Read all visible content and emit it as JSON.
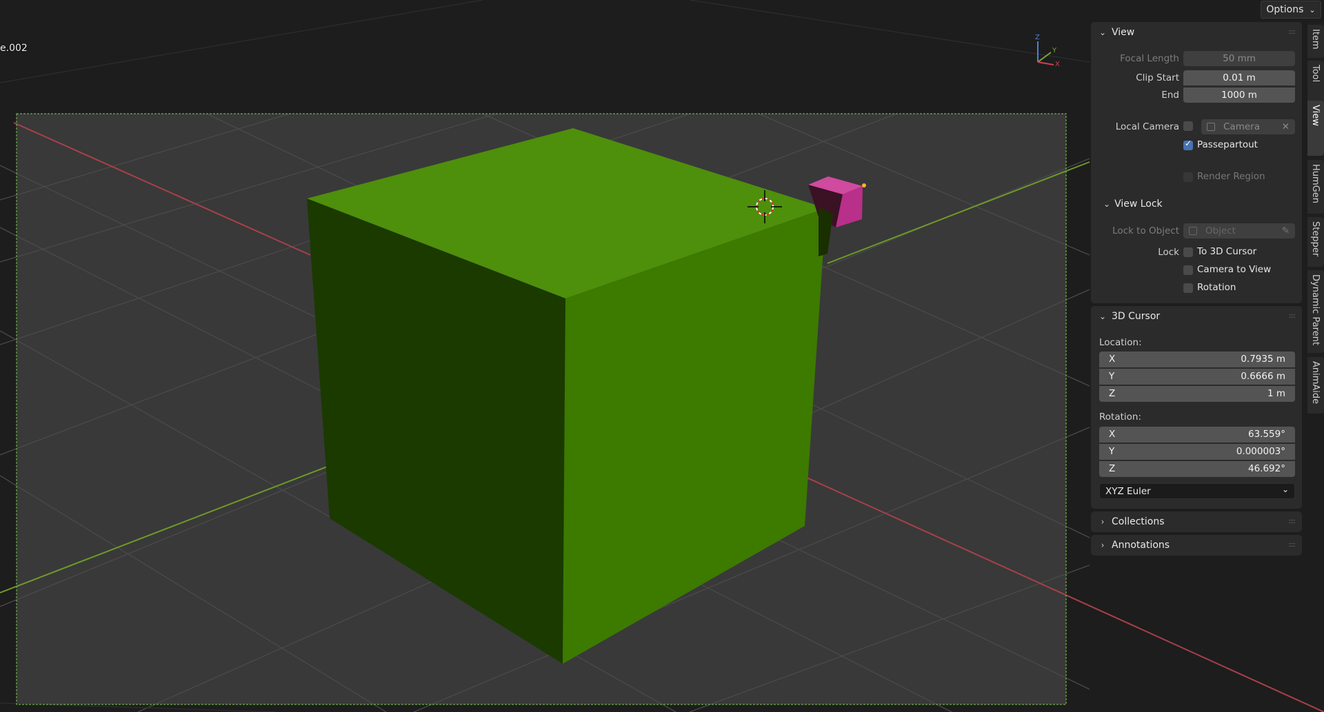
{
  "overlay": {
    "line1": "",
    "line2": "e.002"
  },
  "header": {
    "options_label": "Options"
  },
  "gizmo": {
    "z": "Z",
    "y": "Y",
    "x": "X"
  },
  "sidebar": {
    "view_panel": {
      "title": "View",
      "focal_length_label": "Focal Length",
      "focal_length_value": "50 mm",
      "clip_start_label": "Clip Start",
      "clip_start_value": "0.01 m",
      "clip_end_label": "End",
      "clip_end_value": "1000 m",
      "local_camera_label": "Local Camera",
      "local_camera_value": "Camera",
      "passepartout_label": "Passepartout",
      "passepartout_checked": true,
      "render_region_label": "Render Region",
      "view_lock": {
        "title": "View Lock",
        "lock_to_object_label": "Lock to Object",
        "lock_to_object_placeholder": "Object",
        "lock_label": "Lock",
        "to_3d_cursor_label": "To 3D Cursor",
        "camera_to_view_label": "Camera to View",
        "rotation_label": "Rotation"
      }
    },
    "cursor_panel": {
      "title": "3D Cursor",
      "location_label": "Location:",
      "location": [
        {
          "axis": "X",
          "value": "0.7935 m"
        },
        {
          "axis": "Y",
          "value": "0.6666 m"
        },
        {
          "axis": "Z",
          "value": "1 m"
        }
      ],
      "rotation_label": "Rotation:",
      "rotation": [
        {
          "axis": "X",
          "value": "63.559°"
        },
        {
          "axis": "Y",
          "value": "0.000003°"
        },
        {
          "axis": "Z",
          "value": "46.692°"
        }
      ],
      "rotation_mode": "XYZ Euler"
    },
    "collections_panel": {
      "title": "Collections"
    },
    "annotations_panel": {
      "title": "Annotations"
    }
  },
  "tabs": [
    "Item",
    "Tool",
    "View",
    "HumGen",
    "Stepper",
    "Dynamic Parent",
    "AnimAide"
  ],
  "active_tab": "View",
  "colors": {
    "cube_top": "#4e8f0c",
    "cube_right": "#3d7a00",
    "cube_left": "#1a3a00",
    "small_cube": "#c0368f",
    "axis_x": "#a8404a",
    "axis_y": "#6f9a2a",
    "camera_frame": "#6fb04b",
    "accent": "#4772b3"
  }
}
